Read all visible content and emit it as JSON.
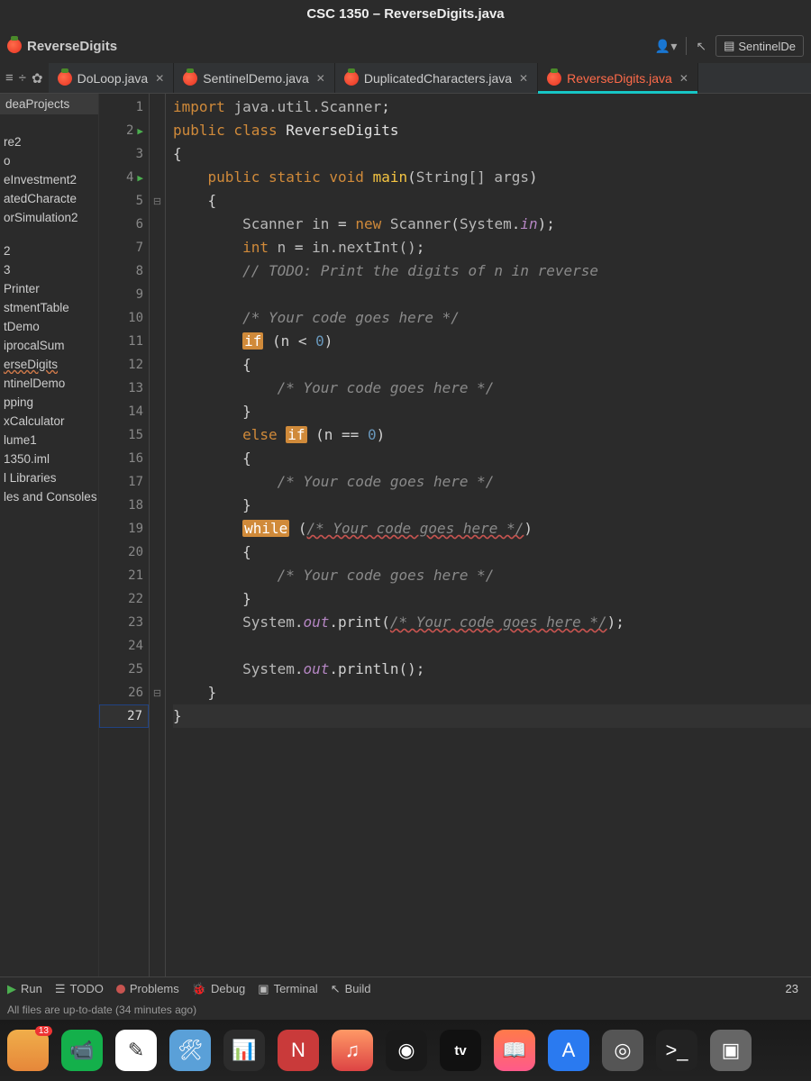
{
  "title": "CSC 1350 – ReverseDigits.java",
  "toolbar": {
    "project_name": "ReverseDigits",
    "right_button": "SentinelDe"
  },
  "tabs": [
    {
      "label": "DoLoop.java",
      "active": false
    },
    {
      "label": "SentinelDemo.java",
      "active": false
    },
    {
      "label": "DuplicatedCharacters.java",
      "active": false
    },
    {
      "label": "ReverseDigits.java",
      "active": true
    }
  ],
  "sidebar": {
    "title": "deaProjects",
    "items": [
      "re2",
      "o",
      "eInvestment2",
      "atedCharacte",
      "orSimulation2",
      "2",
      "3",
      "Printer",
      "stmentTable",
      "tDemo",
      "iprocalSum",
      "erseDigits",
      "ntinelDemo",
      "pping",
      "xCalculator",
      "lume1",
      "1350.iml",
      "l Libraries",
      "les and Consoles"
    ]
  },
  "gutter": {
    "run_lines": [
      2,
      4
    ],
    "current_line": 27,
    "total": 27
  },
  "code": {
    "l1": "import java.util.Scanner;",
    "l2": "public class ReverseDigits",
    "l3": "{",
    "l4": "    public static void main(String[] args)",
    "l5": "    {",
    "l6": "        Scanner in = new Scanner(System.in);",
    "l7": "        int n = in.nextInt();",
    "l8": "        // TODO: Print the digits of n in reverse",
    "l9": "",
    "l10": "        /* Your code goes here */",
    "l11": "        if (n < 0)",
    "l12": "        {",
    "l13": "            /* Your code goes here */",
    "l14": "        }",
    "l15": "        else if (n == 0)",
    "l16": "        {",
    "l17": "            /* Your code goes here */",
    "l18": "        }",
    "l19": "        while (/* Your code goes here */)",
    "l20": "        {",
    "l21": "            /* Your code goes here */",
    "l22": "        }",
    "l23": "        System.out.print(/* Your code goes here */);",
    "l24": "",
    "l25": "        System.out.println();",
    "l26": "    }",
    "l27": "}"
  },
  "bottom_tabs": {
    "run": "Run",
    "todo": "TODO",
    "problems": "Problems",
    "debug": "Debug",
    "terminal": "Terminal",
    "build": "Build",
    "right_number": "23"
  },
  "status": "All files are up-to-date (34 minutes ago)",
  "dock": {
    "badge": "13",
    "tv_label": "tv"
  }
}
